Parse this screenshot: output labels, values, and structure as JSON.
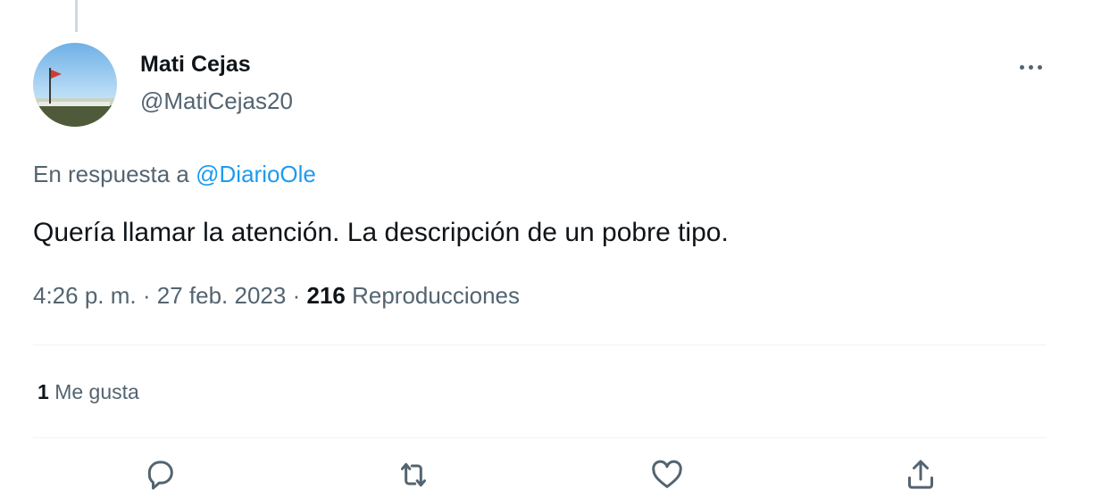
{
  "author": {
    "display_name": "Mati Cejas",
    "handle": "@MatiCejas20",
    "avatar": "profile-photo"
  },
  "more_icon": "more-horizontal-icon",
  "reply": {
    "prefix": "En respuesta a",
    "mention": "@DiarioOle"
  },
  "tweet": {
    "text": "Quería llamar la atención. La descripción de un pobre tipo."
  },
  "meta": {
    "time": "4:26 p. m.",
    "separator": "·",
    "date": "27 feb. 2023",
    "views_count": "216",
    "views_label": "Reproducciones"
  },
  "likes": {
    "count": "1",
    "label": "Me gusta"
  },
  "actions": [
    {
      "icon": "reply-icon"
    },
    {
      "icon": "retweet-icon"
    },
    {
      "icon": "heart-icon"
    },
    {
      "icon": "share-icon"
    }
  ],
  "colors": {
    "text_primary": "#0f1419",
    "text_secondary": "#536471",
    "link": "#1d9bf0",
    "divider": "#eff3f4"
  }
}
